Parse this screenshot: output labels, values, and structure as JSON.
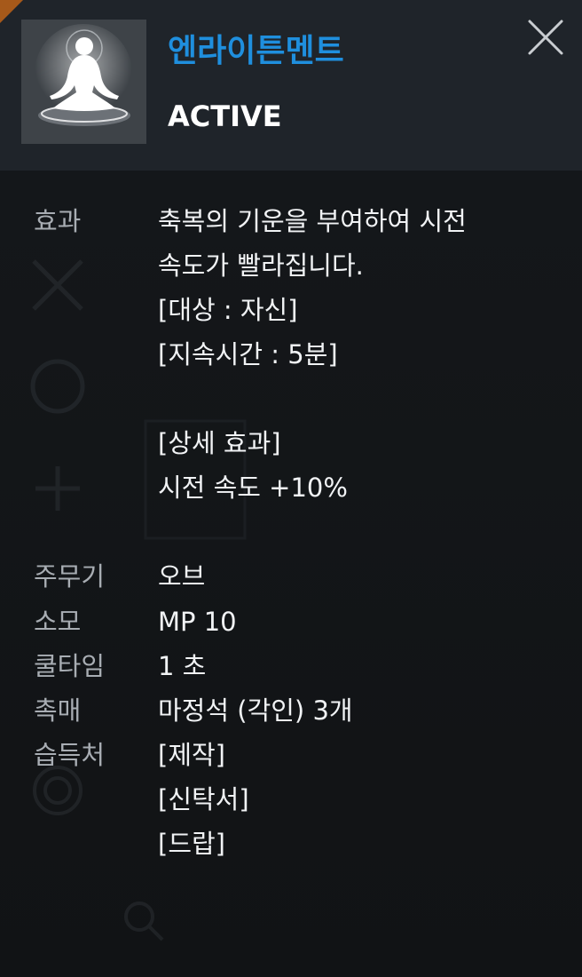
{
  "skill": {
    "name": "엔라이튼멘트",
    "type": "ACTIVE",
    "icon": "meditation-icon"
  },
  "close_icon": "close-icon",
  "details": {
    "effect": {
      "label": "효과",
      "lines": [
        "축복의 기운을 부여하여 시전",
        "속도가 빨라집니다.",
        "[대상 : 자신]",
        "[지속시간 : 5분]",
        "",
        "[상세 효과]",
        "시전 속도 +10%"
      ]
    },
    "weapon": {
      "label": "주무기",
      "value": "오브"
    },
    "cost": {
      "label": "소모",
      "value": "MP 10"
    },
    "cooldown": {
      "label": "쿨타임",
      "value": "1 초"
    },
    "catalyst": {
      "label": "촉매",
      "value": "마정석 (각인) 3개"
    },
    "source": {
      "label": "습득처",
      "lines": [
        "[제작]",
        "[신탁서]",
        "[드랍]"
      ]
    }
  },
  "colors": {
    "accent": "#1f8fde",
    "header_bg": "#1f242a",
    "body_bg": "#131517",
    "corner": "#b55f18"
  }
}
